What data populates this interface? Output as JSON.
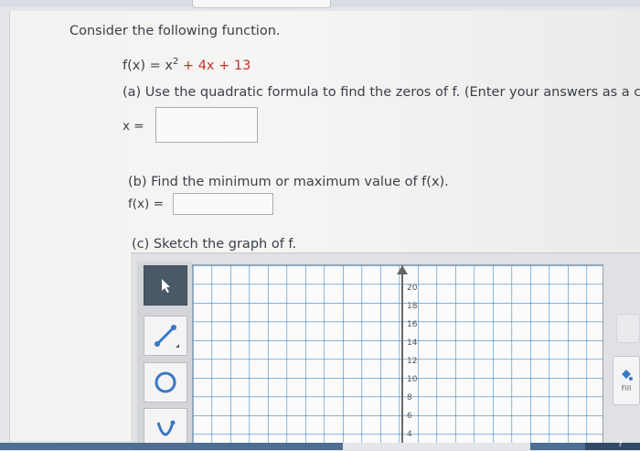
{
  "problem": {
    "intro": "Consider the following function.",
    "function_lhs": "f(x) = x",
    "function_exponent": "2",
    "function_rhs_terms": " + 4x + 13",
    "part_a": "(a) Use the quadratic formula to find the zeros of f. (Enter your answers as a c",
    "part_a_label": "x =",
    "part_b": "(b) Find the minimum or maximum value of f(x).",
    "part_b_label": "f(x) =",
    "part_c": "(c) Sketch the graph of f."
  },
  "graph_tool": {
    "tools": [
      {
        "name": "pointer-icon"
      },
      {
        "name": "line-icon"
      },
      {
        "name": "circle-icon"
      },
      {
        "name": "parabola-icon"
      }
    ],
    "y_ticks": [
      "20",
      "18",
      "16",
      "14",
      "12",
      "10",
      "8",
      "6",
      "4"
    ],
    "fill_label": "Fill",
    "bottom_right_label": "?"
  },
  "colors": {
    "accent_red": "#c5302e",
    "tool_active": "#4a5968",
    "tool_icon_blue": "#3a78c4"
  }
}
